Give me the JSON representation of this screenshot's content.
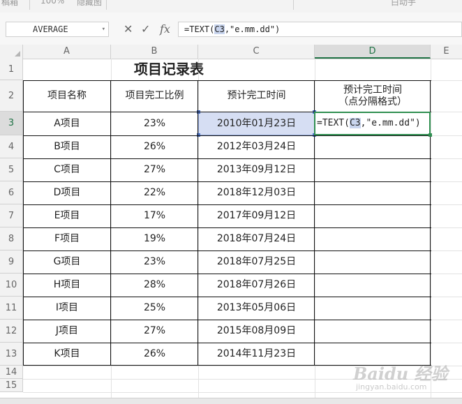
{
  "ribbon": {
    "left_text": "稿箱",
    "item1": "100%",
    "item2": "隐藏图",
    "right_text": "白动手"
  },
  "name_box": {
    "value": "AVERAGE",
    "dropdown_icon": "chevron-down-icon"
  },
  "formula_bar": {
    "cancel_icon": "close-icon",
    "cancel_glyph": "✕",
    "confirm_icon": "check-icon",
    "confirm_glyph": "✓",
    "fx_label": "fx",
    "formula_pre": "=TEXT(",
    "formula_ref": "C3",
    "formula_post": ",\"e.mm.dd\")"
  },
  "columns": [
    "A",
    "B",
    "C",
    "D",
    "E"
  ],
  "rows": [
    "1",
    "2",
    "3",
    "4",
    "5",
    "6",
    "7",
    "8",
    "9",
    "10",
    "11",
    "12",
    "13",
    "14",
    "15"
  ],
  "active": {
    "column": "D",
    "row": "3"
  },
  "sheet": {
    "title": "项目记录表",
    "headers": [
      "项目名称",
      "项目完工比例",
      "预计完工时间",
      "预计完工时间",
      "（点分隔格式）"
    ],
    "records": [
      {
        "name": "A项目",
        "ratio": "23%",
        "date": "2010年01月23日"
      },
      {
        "name": "B项目",
        "ratio": "26%",
        "date": "2012年03月24日"
      },
      {
        "name": "C项目",
        "ratio": "27%",
        "date": "2013年09月12日"
      },
      {
        "name": "D项目",
        "ratio": "22%",
        "date": "2018年12月03日"
      },
      {
        "name": "E项目",
        "ratio": "17%",
        "date": "2017年09月12日"
      },
      {
        "name": "F项目",
        "ratio": "19%",
        "date": "2018年07月24日"
      },
      {
        "name": "G项目",
        "ratio": "23%",
        "date": "2018年07月25日"
      },
      {
        "name": "H项目",
        "ratio": "28%",
        "date": "2018年07月26日"
      },
      {
        "name": "I项目",
        "ratio": "25%",
        "date": "2013年05月06日"
      },
      {
        "name": "J项目",
        "ratio": "27%",
        "date": "2015年08月09日"
      },
      {
        "name": "K项目",
        "ratio": "26%",
        "date": "2014年11月23日"
      }
    ]
  },
  "edit_cell": {
    "pre": "=TEXT(",
    "ref": "C3",
    "post": ",\"e.mm.dd\")"
  },
  "watermark": {
    "main": "Baidu 经验",
    "sub": "jingyan.baidu.com"
  },
  "colors": {
    "accent_green": "#217346",
    "selection_fill": "#d6def3",
    "ref_highlight": "#c9d5ee"
  }
}
